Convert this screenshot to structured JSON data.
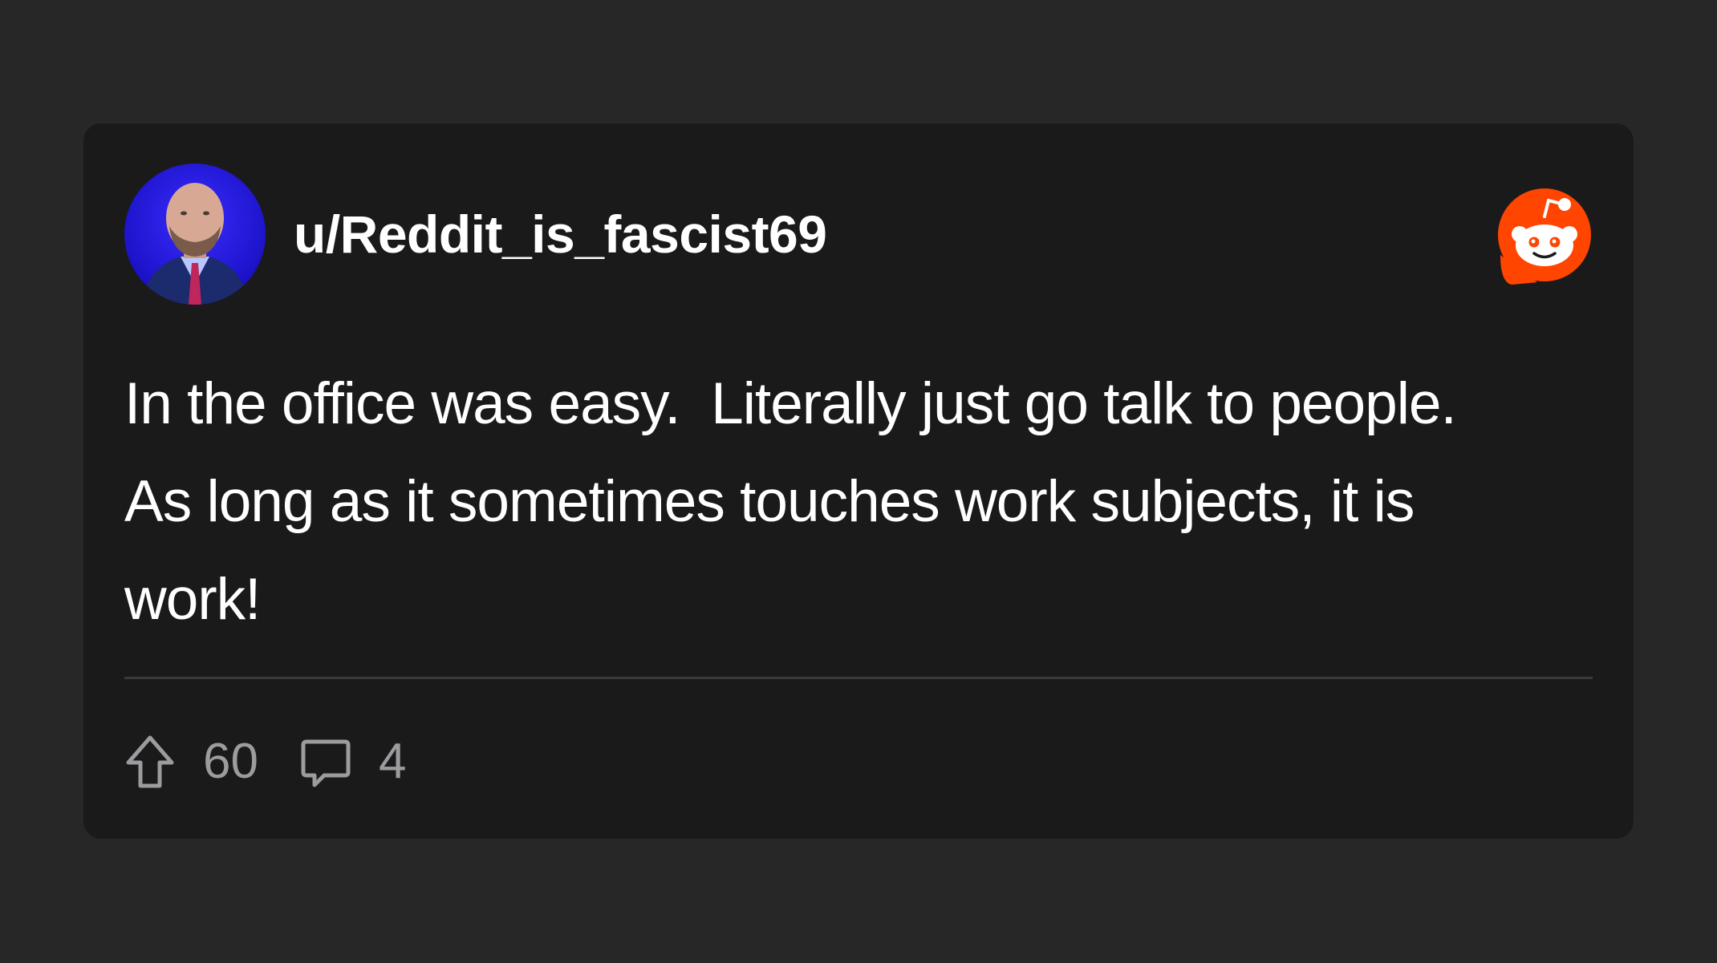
{
  "post": {
    "username": "u/Reddit_is_fascist69",
    "body": "In the office was easy.  Literally just go talk to people.\nAs long as it sometimes touches work subjects, it is\nwork!",
    "upvotes": "60",
    "comments": "4"
  },
  "icons": {
    "brand": "reddit-logo-icon",
    "upvote": "upvote-arrow-icon",
    "comment": "comment-bubble-icon"
  },
  "colors": {
    "page_background": "#272727",
    "card_background": "#1a1a1b",
    "text_primary": "#ffffff",
    "text_secondary": "#9c9c9f",
    "reddit_orange": "#ff4500",
    "avatar_background": "#1a14e0"
  }
}
